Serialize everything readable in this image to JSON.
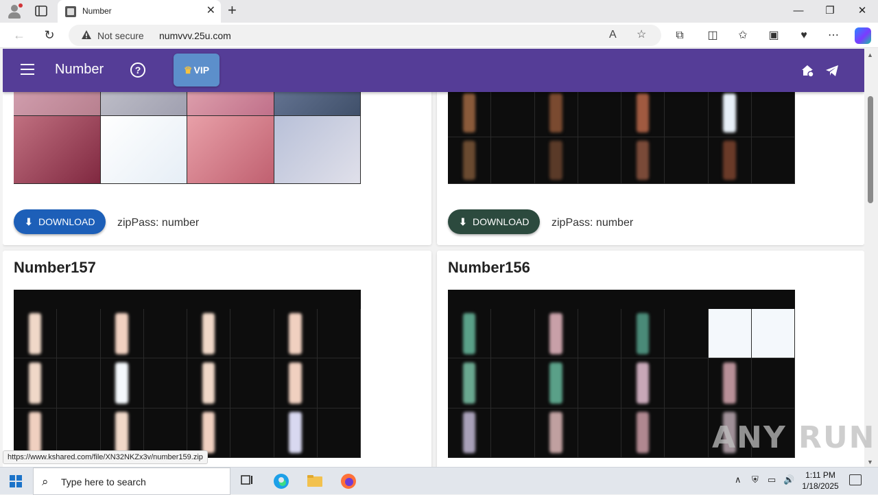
{
  "browser": {
    "tab_title": "Number",
    "address": {
      "security_label": "Not secure",
      "url": "numvvv.25u.com"
    },
    "status_url": "https://www.kshared.com/file/XN32NKZx3v/number159.zip"
  },
  "appbar": {
    "brand": "Number",
    "help_symbol": "?",
    "vip_label": "VIP"
  },
  "cards": [
    {
      "title": "",
      "download_label": "DOWNLOAD",
      "zip_pass": "zipPass: number",
      "button_color": "#1d5fb8"
    },
    {
      "title": "",
      "download_label": "DOWNLOAD",
      "zip_pass": "zipPass: number",
      "button_color": "#2c4a3e"
    },
    {
      "title": "Number157"
    },
    {
      "title": "Number156"
    }
  ],
  "watermark": "ANY RUN",
  "taskbar": {
    "search_placeholder": "Type here to search",
    "time": "1:11 PM",
    "date": "1/18/2025"
  },
  "colors": {
    "appbar": "#553d97",
    "vip_button": "#5c8fcb"
  }
}
